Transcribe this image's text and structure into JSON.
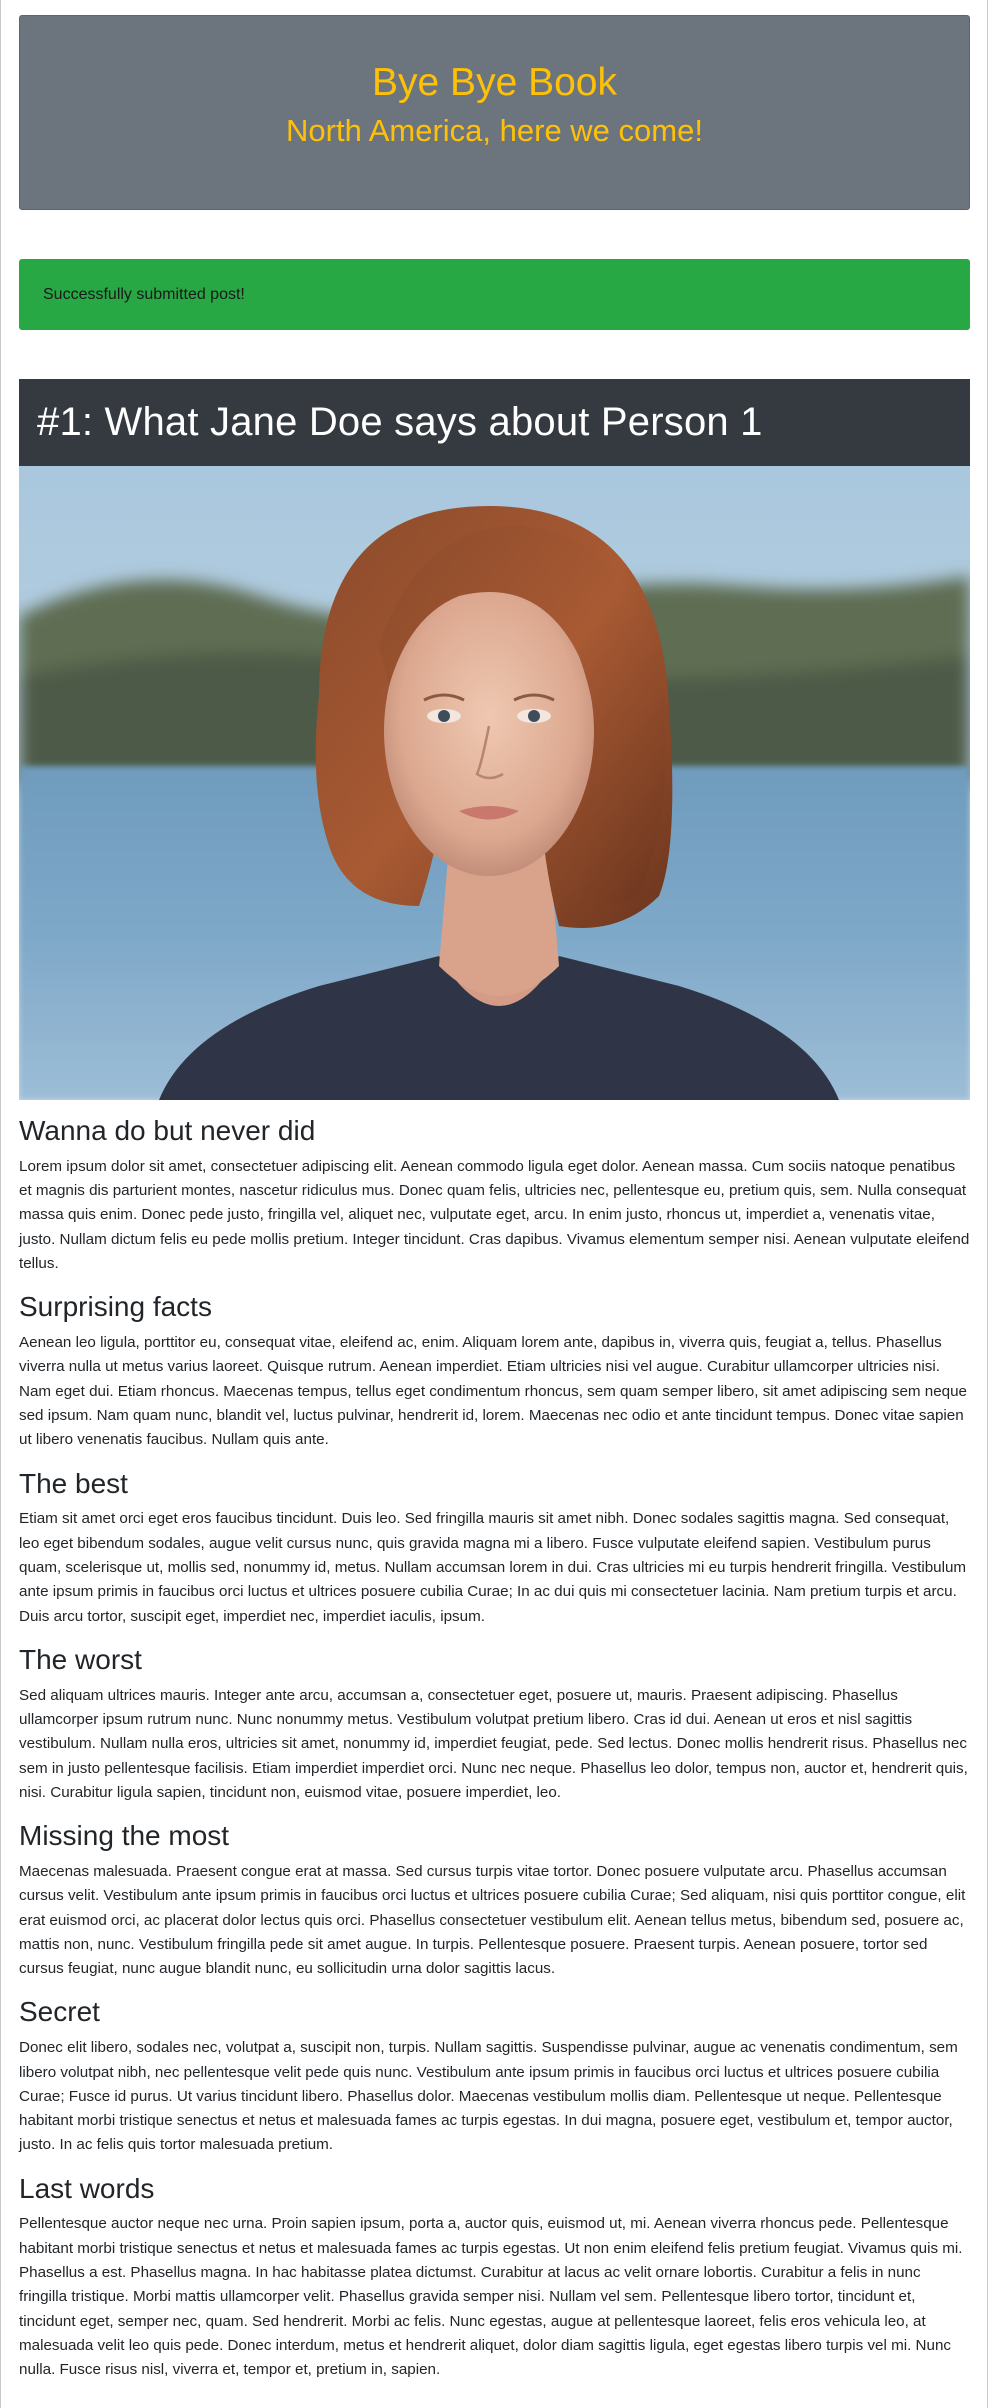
{
  "header": {
    "title": "Bye Bye Book",
    "subtitle": "North America, here we come!"
  },
  "alert": {
    "message": "Successfully submitted post!"
  },
  "post": {
    "title": "#1: What Jane Doe says about Person 1",
    "sections": [
      {
        "heading": "Wanna do but never did",
        "body": "Lorem ipsum dolor sit amet, consectetuer adipiscing elit. Aenean commodo ligula eget dolor. Aenean massa. Cum sociis natoque penatibus et magnis dis parturient montes, nascetur ridiculus mus. Donec quam felis, ultricies nec, pellentesque eu, pretium quis, sem. Nulla consequat massa quis enim. Donec pede justo, fringilla vel, aliquet nec, vulputate eget, arcu. In enim justo, rhoncus ut, imperdiet a, venenatis vitae, justo. Nullam dictum felis eu pede mollis pretium. Integer tincidunt. Cras dapibus. Vivamus elementum semper nisi. Aenean vulputate eleifend tellus."
      },
      {
        "heading": "Surprising facts",
        "body": "Aenean leo ligula, porttitor eu, consequat vitae, eleifend ac, enim. Aliquam lorem ante, dapibus in, viverra quis, feugiat a, tellus. Phasellus viverra nulla ut metus varius laoreet. Quisque rutrum. Aenean imperdiet. Etiam ultricies nisi vel augue. Curabitur ullamcorper ultricies nisi. Nam eget dui. Etiam rhoncus. Maecenas tempus, tellus eget condimentum rhoncus, sem quam semper libero, sit amet adipiscing sem neque sed ipsum. Nam quam nunc, blandit vel, luctus pulvinar, hendrerit id, lorem. Maecenas nec odio et ante tincidunt tempus. Donec vitae sapien ut libero venenatis faucibus. Nullam quis ante."
      },
      {
        "heading": "The best",
        "body": "Etiam sit amet orci eget eros faucibus tincidunt. Duis leo. Sed fringilla mauris sit amet nibh. Donec sodales sagittis magna. Sed consequat, leo eget bibendum sodales, augue velit cursus nunc, quis gravida magna mi a libero. Fusce vulputate eleifend sapien. Vestibulum purus quam, scelerisque ut, mollis sed, nonummy id, metus. Nullam accumsan lorem in dui. Cras ultricies mi eu turpis hendrerit fringilla. Vestibulum ante ipsum primis in faucibus orci luctus et ultrices posuere cubilia Curae; In ac dui quis mi consectetuer lacinia. Nam pretium turpis et arcu. Duis arcu tortor, suscipit eget, imperdiet nec, imperdiet iaculis, ipsum."
      },
      {
        "heading": "The worst",
        "body": "Sed aliquam ultrices mauris. Integer ante arcu, accumsan a, consectetuer eget, posuere ut, mauris. Praesent adipiscing. Phasellus ullamcorper ipsum rutrum nunc. Nunc nonummy metus. Vestibulum volutpat pretium libero. Cras id dui. Aenean ut eros et nisl sagittis vestibulum. Nullam nulla eros, ultricies sit amet, nonummy id, imperdiet feugiat, pede. Sed lectus. Donec mollis hendrerit risus. Phasellus nec sem in justo pellentesque facilisis. Etiam imperdiet imperdiet orci. Nunc nec neque. Phasellus leo dolor, tempus non, auctor et, hendrerit quis, nisi. Curabitur ligula sapien, tincidunt non, euismod vitae, posuere imperdiet, leo."
      },
      {
        "heading": "Missing the most",
        "body": "Maecenas malesuada. Praesent congue erat at massa. Sed cursus turpis vitae tortor. Donec posuere vulputate arcu. Phasellus accumsan cursus velit. Vestibulum ante ipsum primis in faucibus orci luctus et ultrices posuere cubilia Curae; Sed aliquam, nisi quis porttitor congue, elit erat euismod orci, ac placerat dolor lectus quis orci. Phasellus consectetuer vestibulum elit. Aenean tellus metus, bibendum sed, posuere ac, mattis non, nunc. Vestibulum fringilla pede sit amet augue. In turpis. Pellentesque posuere. Praesent turpis. Aenean posuere, tortor sed cursus feugiat, nunc augue blandit nunc, eu sollicitudin urna dolor sagittis lacus."
      },
      {
        "heading": "Secret",
        "body": "Donec elit libero, sodales nec, volutpat a, suscipit non, turpis. Nullam sagittis. Suspendisse pulvinar, augue ac venenatis condimentum, sem libero volutpat nibh, nec pellentesque velit pede quis nunc. Vestibulum ante ipsum primis in faucibus orci luctus et ultrices posuere cubilia Curae; Fusce id purus. Ut varius tincidunt libero. Phasellus dolor. Maecenas vestibulum mollis diam. Pellentesque ut neque. Pellentesque habitant morbi tristique senectus et netus et malesuada fames ac turpis egestas. In dui magna, posuere eget, vestibulum et, tempor auctor, justo. In ac felis quis tortor malesuada pretium."
      },
      {
        "heading": "Last words",
        "body": "Pellentesque auctor neque nec urna. Proin sapien ipsum, porta a, auctor quis, euismod ut, mi. Aenean viverra rhoncus pede. Pellentesque habitant morbi tristique senectus et netus et malesuada fames ac turpis egestas. Ut non enim eleifend felis pretium feugiat. Vivamus quis mi. Phasellus a est. Phasellus magna. In hac habitasse platea dictumst. Curabitur at lacus ac velit ornare lobortis. Curabitur a felis in nunc fringilla tristique. Morbi mattis ullamcorper velit. Phasellus gravida semper nisi. Nullam vel sem. Pellentesque libero tortor, tincidunt et, tincidunt eget, semper nec, quam. Sed hendrerit. Morbi ac felis. Nunc egestas, augue at pellentesque laoreet, felis eros vehicula leo, at malesuada velit leo quis pede. Donec interdum, metus et hendrerit aliquet, dolor diam sagittis ligula, eget egestas libero turpis vel mi. Nunc nulla. Fusce risus nisl, viverra et, tempor et, pretium in, sapien."
      }
    ]
  },
  "colors": {
    "header_bg": "#6c757d",
    "header_text": "#ffc107",
    "alert_bg": "#28a745",
    "title_bar_bg": "#343a40"
  }
}
